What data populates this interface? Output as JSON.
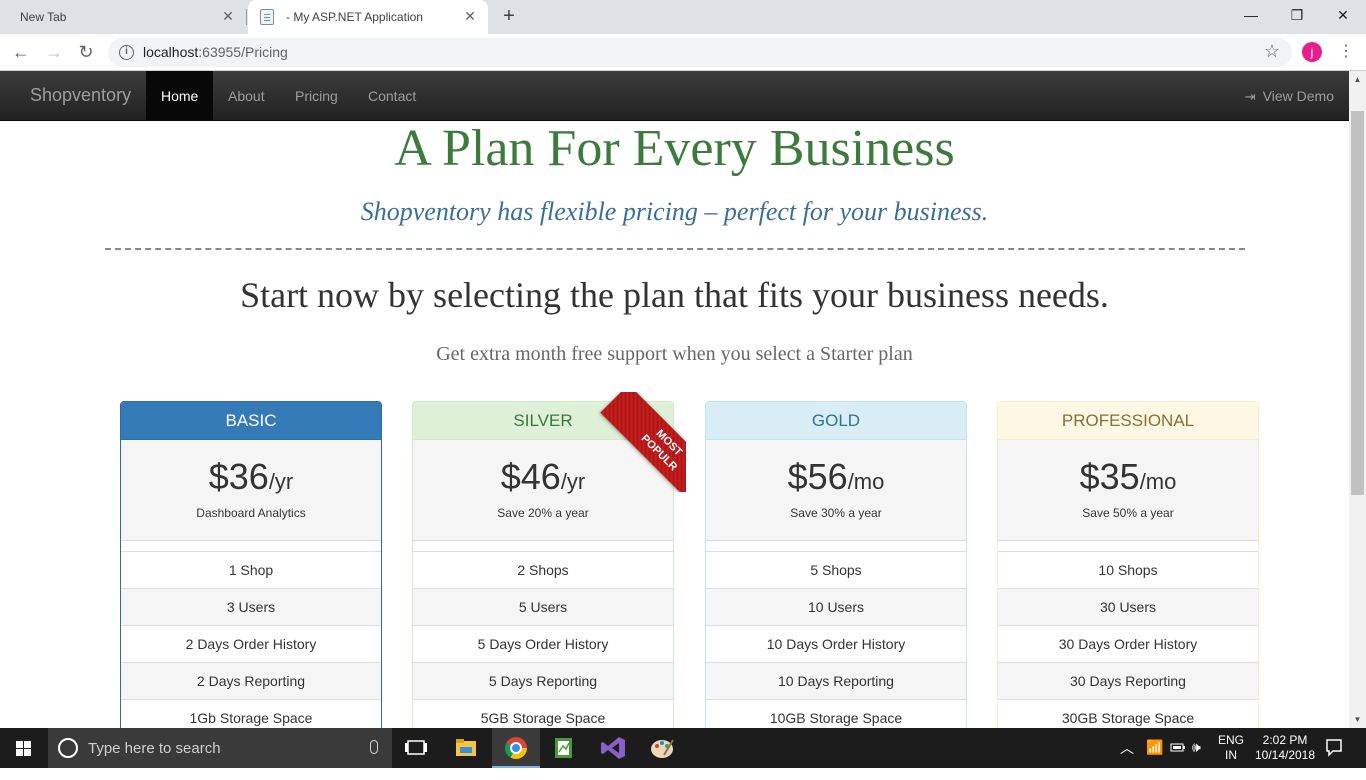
{
  "browser": {
    "tabs": [
      {
        "title": "New Tab"
      },
      {
        "title": "- My ASP.NET Application"
      }
    ],
    "url_host": "localhost",
    "url_rest": ":63955/Pricing",
    "avatar_letter": "j"
  },
  "navbar": {
    "brand": "Shopventory",
    "items": [
      {
        "label": "Home",
        "active": true
      },
      {
        "label": "About"
      },
      {
        "label": "Pricing"
      },
      {
        "label": "Contact"
      }
    ],
    "right_label": "View Demo"
  },
  "hero": {
    "title": "A Plan For Every Business",
    "tagline": "Shopventory has flexible pricing – perfect for your business.",
    "start_text": "Start now by selecting the plan that fits your business needs.",
    "extra_text": "Get extra month free support when you select a Starter plan"
  },
  "plans": [
    {
      "name": "BASIC",
      "price": "$36",
      "period": "/yr",
      "subtext": "Dashboard Analytics",
      "features": [
        "1 Shop",
        "3 Users",
        "2 Days Order History",
        "2 Days Reporting",
        "1Gb Storage Space"
      ]
    },
    {
      "name": "SILVER",
      "price": "$46",
      "period": "/yr",
      "subtext": "Save 20% a year",
      "ribbon": "MOST POPULR",
      "features": [
        "2 Shops",
        "5 Users",
        "5 Days Order History",
        "5 Days Reporting",
        "5GB Storage Space"
      ]
    },
    {
      "name": "GOLD",
      "price": "$56",
      "period": "/mo",
      "subtext": "Save 30% a year",
      "features": [
        "5 Shops",
        "10 Users",
        "10 Days Order History",
        "10 Days Reporting",
        "10GB Storage Space"
      ]
    },
    {
      "name": "PROFESSIONAL",
      "price": "$35",
      "period": "/mo",
      "subtext": "Save 50% a year",
      "features": [
        "10 Shops",
        "30 Users",
        "30 Days Order History",
        "30 Days Reporting",
        "30GB Storage Space"
      ]
    }
  ],
  "ribbon_lines": [
    "MOST",
    "POPULR"
  ],
  "taskbar": {
    "search_placeholder": "Type here to search",
    "lang_top": "ENG",
    "lang_bottom": "IN",
    "time": "2:02 PM",
    "date": "10/14/2018"
  },
  "colors": {
    "title_green": "#3d7a3d",
    "tagline_blue": "#3a6e9a",
    "basic": "#337ab7",
    "silver": "#dff0d8",
    "gold": "#d9edf7",
    "professional": "#fcf8e3",
    "ribbon": "#c41e1e"
  }
}
